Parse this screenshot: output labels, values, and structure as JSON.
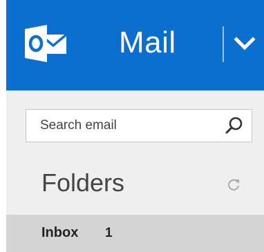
{
  "header": {
    "app_title": "Mail",
    "logo_icon": "outlook-logo-icon",
    "switch_icon": "chevron-down-icon",
    "background_color": "#0b6fcf"
  },
  "search": {
    "placeholder": "Search email",
    "value": "",
    "icon": "search-icon"
  },
  "folders": {
    "title": "Folders",
    "refresh_icon": "refresh-icon",
    "items": [
      {
        "label": "Inbox",
        "count": "1",
        "selected": true
      }
    ]
  }
}
